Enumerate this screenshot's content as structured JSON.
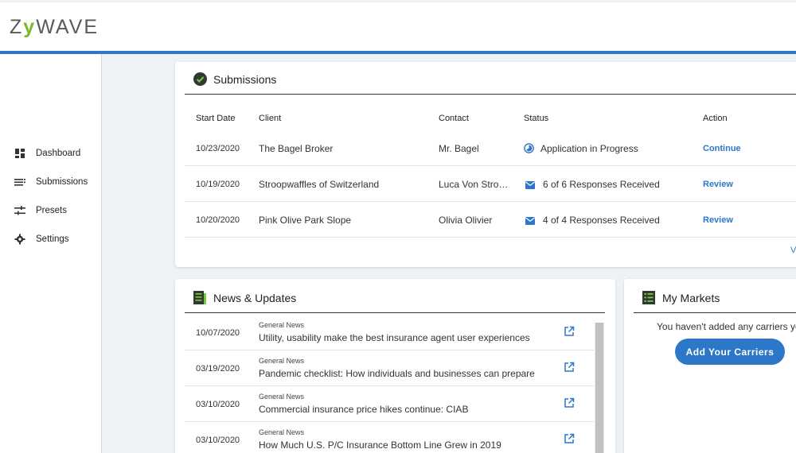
{
  "header": {
    "logo": "ZYWAVE",
    "logo_z": "Z",
    "logo_y": "y",
    "logo_rest": "WAVE"
  },
  "sidebar": {
    "items": [
      {
        "label": "Dashboard",
        "icon": "dashboard-icon"
      },
      {
        "label": "Submissions",
        "icon": "list-icon"
      },
      {
        "label": "Presets",
        "icon": "sliders-icon"
      },
      {
        "label": "Settings",
        "icon": "gear-icon"
      }
    ]
  },
  "submissions": {
    "title": "Submissions",
    "columns": [
      "Start Date",
      "Client",
      "Contact",
      "Status",
      "Action"
    ],
    "rows": [
      {
        "date": "10/23/2020",
        "client": "The Bagel Broker",
        "contact": "Mr. Bagel",
        "status": "Application in Progress",
        "status_icon": "progress-icon",
        "action": "Continue"
      },
      {
        "date": "10/19/2020",
        "client": "Stroopwaffles of Switzerland",
        "contact": "Luca Von Stro…",
        "status": "6 of 6 Responses Received",
        "status_icon": "mail-icon",
        "action": "Review"
      },
      {
        "date": "10/20/2020",
        "client": "Pink Olive Park Slope",
        "contact": "Olivia Olivier",
        "status": "4 of 4 Responses Received",
        "status_icon": "mail-icon",
        "action": "Review"
      }
    ],
    "footer_link": "V"
  },
  "news": {
    "title": "News & Updates",
    "items": [
      {
        "date": "10/07/2020",
        "category": "General News",
        "title": "Utility, usability make the best insurance agent user experiences"
      },
      {
        "date": "03/19/2020",
        "category": "General News",
        "title": "Pandemic checklist: How individuals and businesses can prepare"
      },
      {
        "date": "03/10/2020",
        "category": "General News",
        "title": "Commercial insurance price hikes continue: CIAB"
      },
      {
        "date": "03/10/2020",
        "category": "General News",
        "title": "How Much U.S. P/C Insurance Bottom Line Grew in 2019"
      }
    ]
  },
  "markets": {
    "title": "My Markets",
    "empty_text": "You haven't added any carriers ye",
    "button_label": "Add Your Carriers"
  },
  "colors": {
    "accent": "#2d77c9",
    "logo_green": "#7ab929",
    "check_green": "#4caf50"
  }
}
